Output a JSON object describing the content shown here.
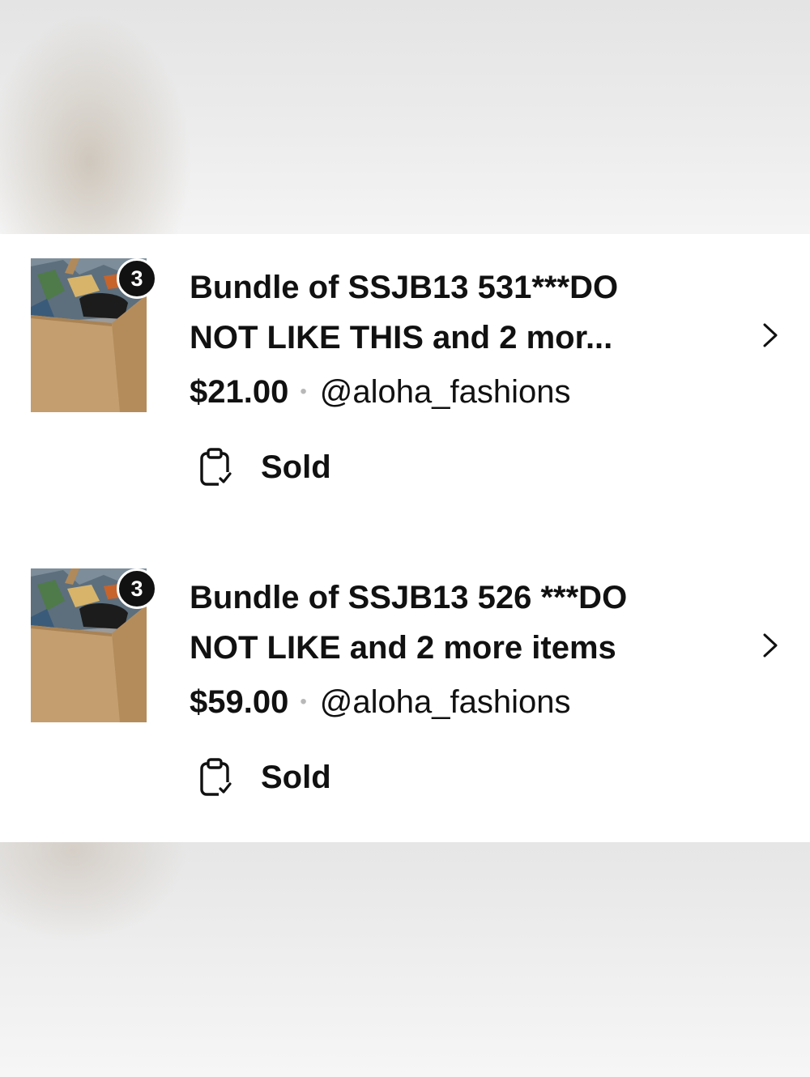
{
  "orders": [
    {
      "item_count_badge": "3",
      "title_line1": "Bundle of SSJB13 531***DO",
      "title_line2": "NOT LIKE THIS and 2 mor...",
      "price": "$21.00",
      "separator": "•",
      "seller": "@aloha_fashions",
      "status_icon": "clipboard-check-icon",
      "status": "Sold"
    },
    {
      "item_count_badge": "3",
      "title_line1": "Bundle of SSJB13 526 ***DO",
      "title_line2": "NOT LIKE and 2 more items",
      "price": "$59.00",
      "separator": "•",
      "seller": "@aloha_fashions",
      "status_icon": "clipboard-check-icon",
      "status": "Sold"
    }
  ],
  "colors": {
    "text": "#111111",
    "badge_bg": "#111111",
    "separator": "#b8b8b8",
    "card_bg": "#ffffff",
    "background_blur": "#eeeeee"
  }
}
